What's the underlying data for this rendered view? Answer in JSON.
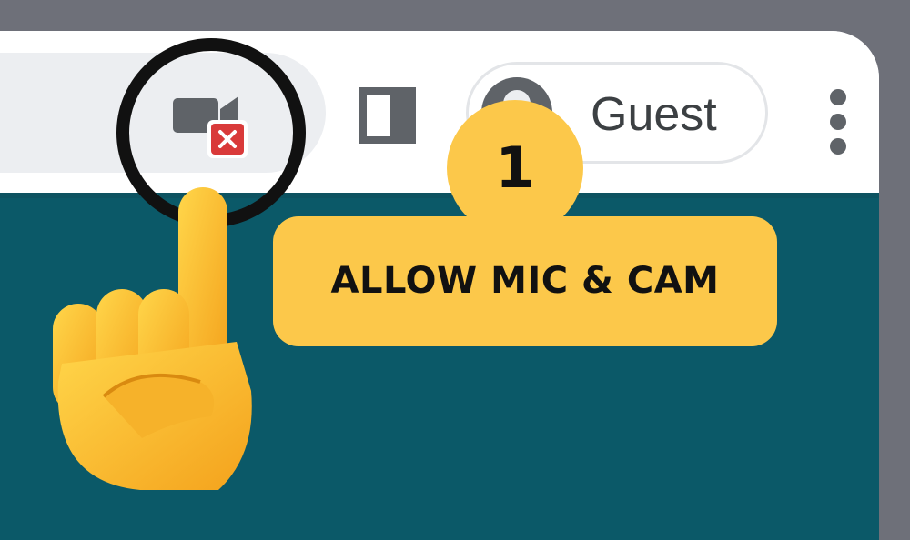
{
  "browser": {
    "camera_status_icon": "camera-blocked-icon",
    "side_panel_icon": "side-panel-icon",
    "profile": {
      "avatar_icon": "person-avatar-icon",
      "label": "Guest"
    },
    "menu_icon": "vertical-ellipsis-icon"
  },
  "annotation": {
    "highlight_icon": "circle-highlight",
    "pointer_icon": "pointing-hand-emoji",
    "step_number": "1",
    "instruction": "ALLOW MIC & CAM"
  },
  "colors": {
    "accent_yellow": "#fcc84a",
    "page_teal": "#0b5968",
    "blocked_red": "#d93a3a"
  }
}
